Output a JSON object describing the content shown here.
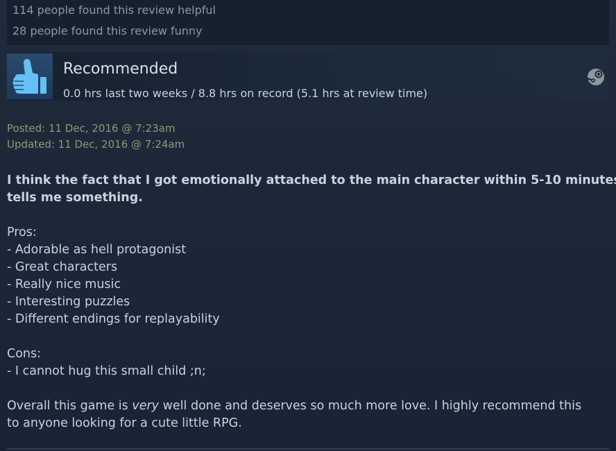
{
  "stats": {
    "helpful": "114 people found this review helpful",
    "funny": "28 people found this review funny"
  },
  "header": {
    "verdict": "Recommended",
    "hours": "0.0 hrs last two weeks / 8.8 hrs on record (5.1 hrs at review time)",
    "thumb_icon": "thumbs-up-icon",
    "platform_icon": "steam-icon"
  },
  "dates": {
    "posted": "Posted: 11 Dec, 2016 @ 7:23am",
    "updated": "Updated: 11 Dec, 2016 @ 7:24am"
  },
  "review": {
    "intro_line1": "I think the fact that I got emotionally attached to the main character within 5-10 minutes",
    "intro_line2": "tells me something.",
    "pros_heading": "Pros:",
    "pros": [
      "- Adorable as hell protagonist",
      "- Great characters",
      "- Really nice music",
      "- Interesting puzzles",
      "- Different endings for replayability"
    ],
    "cons_heading": "Cons:",
    "cons": [
      "- I cannot hug this small child ;n;"
    ],
    "overall_pre": "Overall this game is ",
    "overall_emph": "very",
    "overall_post": " well done and deserves so much more love. I highly recommend this",
    "overall_line2": "to anyone looking for a cute little RPG."
  },
  "colors": {
    "background": "#1b2838",
    "text": "#c6d4df",
    "muted": "#8f98a0",
    "date_text": "#8a9a7b",
    "thumb_blue": "#66c0f4"
  }
}
